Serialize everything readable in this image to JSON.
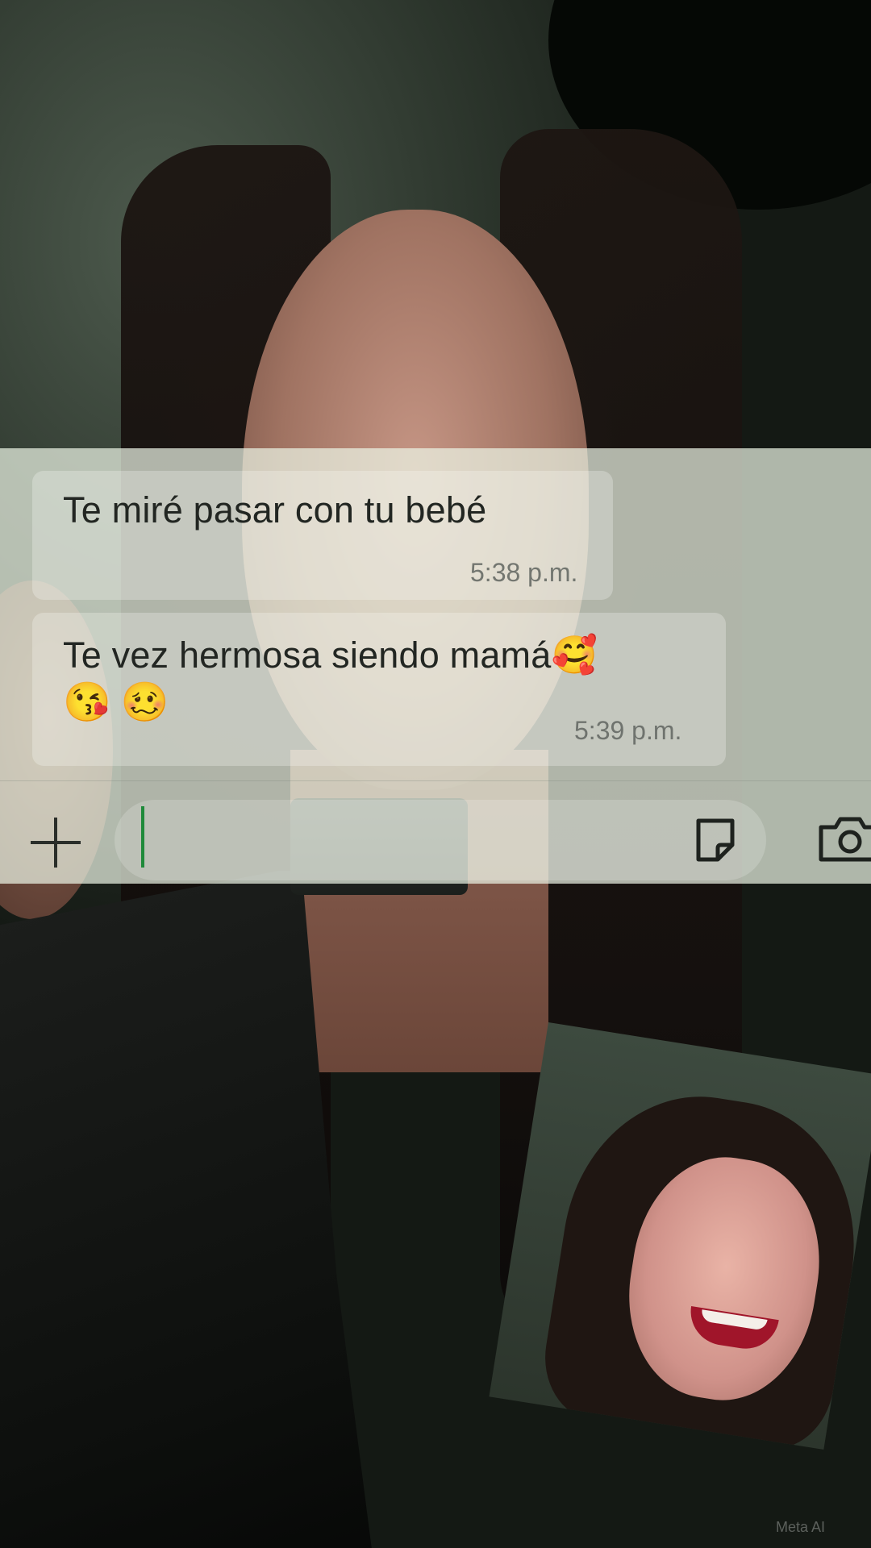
{
  "conversation": {
    "messages": [
      {
        "text": "Te miré pasar con tu bebé",
        "emoji_inline": "",
        "emoji_row": [],
        "time": "5:38 p.m."
      },
      {
        "text": "Te vez hermosa siendo mamá",
        "emoji_inline": "🥰",
        "emoji_row": [
          "😘",
          "🥴"
        ],
        "time": "5:39 p.m."
      }
    ]
  },
  "input_bar": {
    "icons": [
      "plus-icon",
      "sticker-icon",
      "camera-icon"
    ],
    "caret_color": "#1f8a3a"
  },
  "watermark": {
    "text": "Meta AI"
  },
  "colors": {
    "overlay": "#ecf4e4",
    "text": "#222622",
    "timestamp": "#5f645f"
  }
}
